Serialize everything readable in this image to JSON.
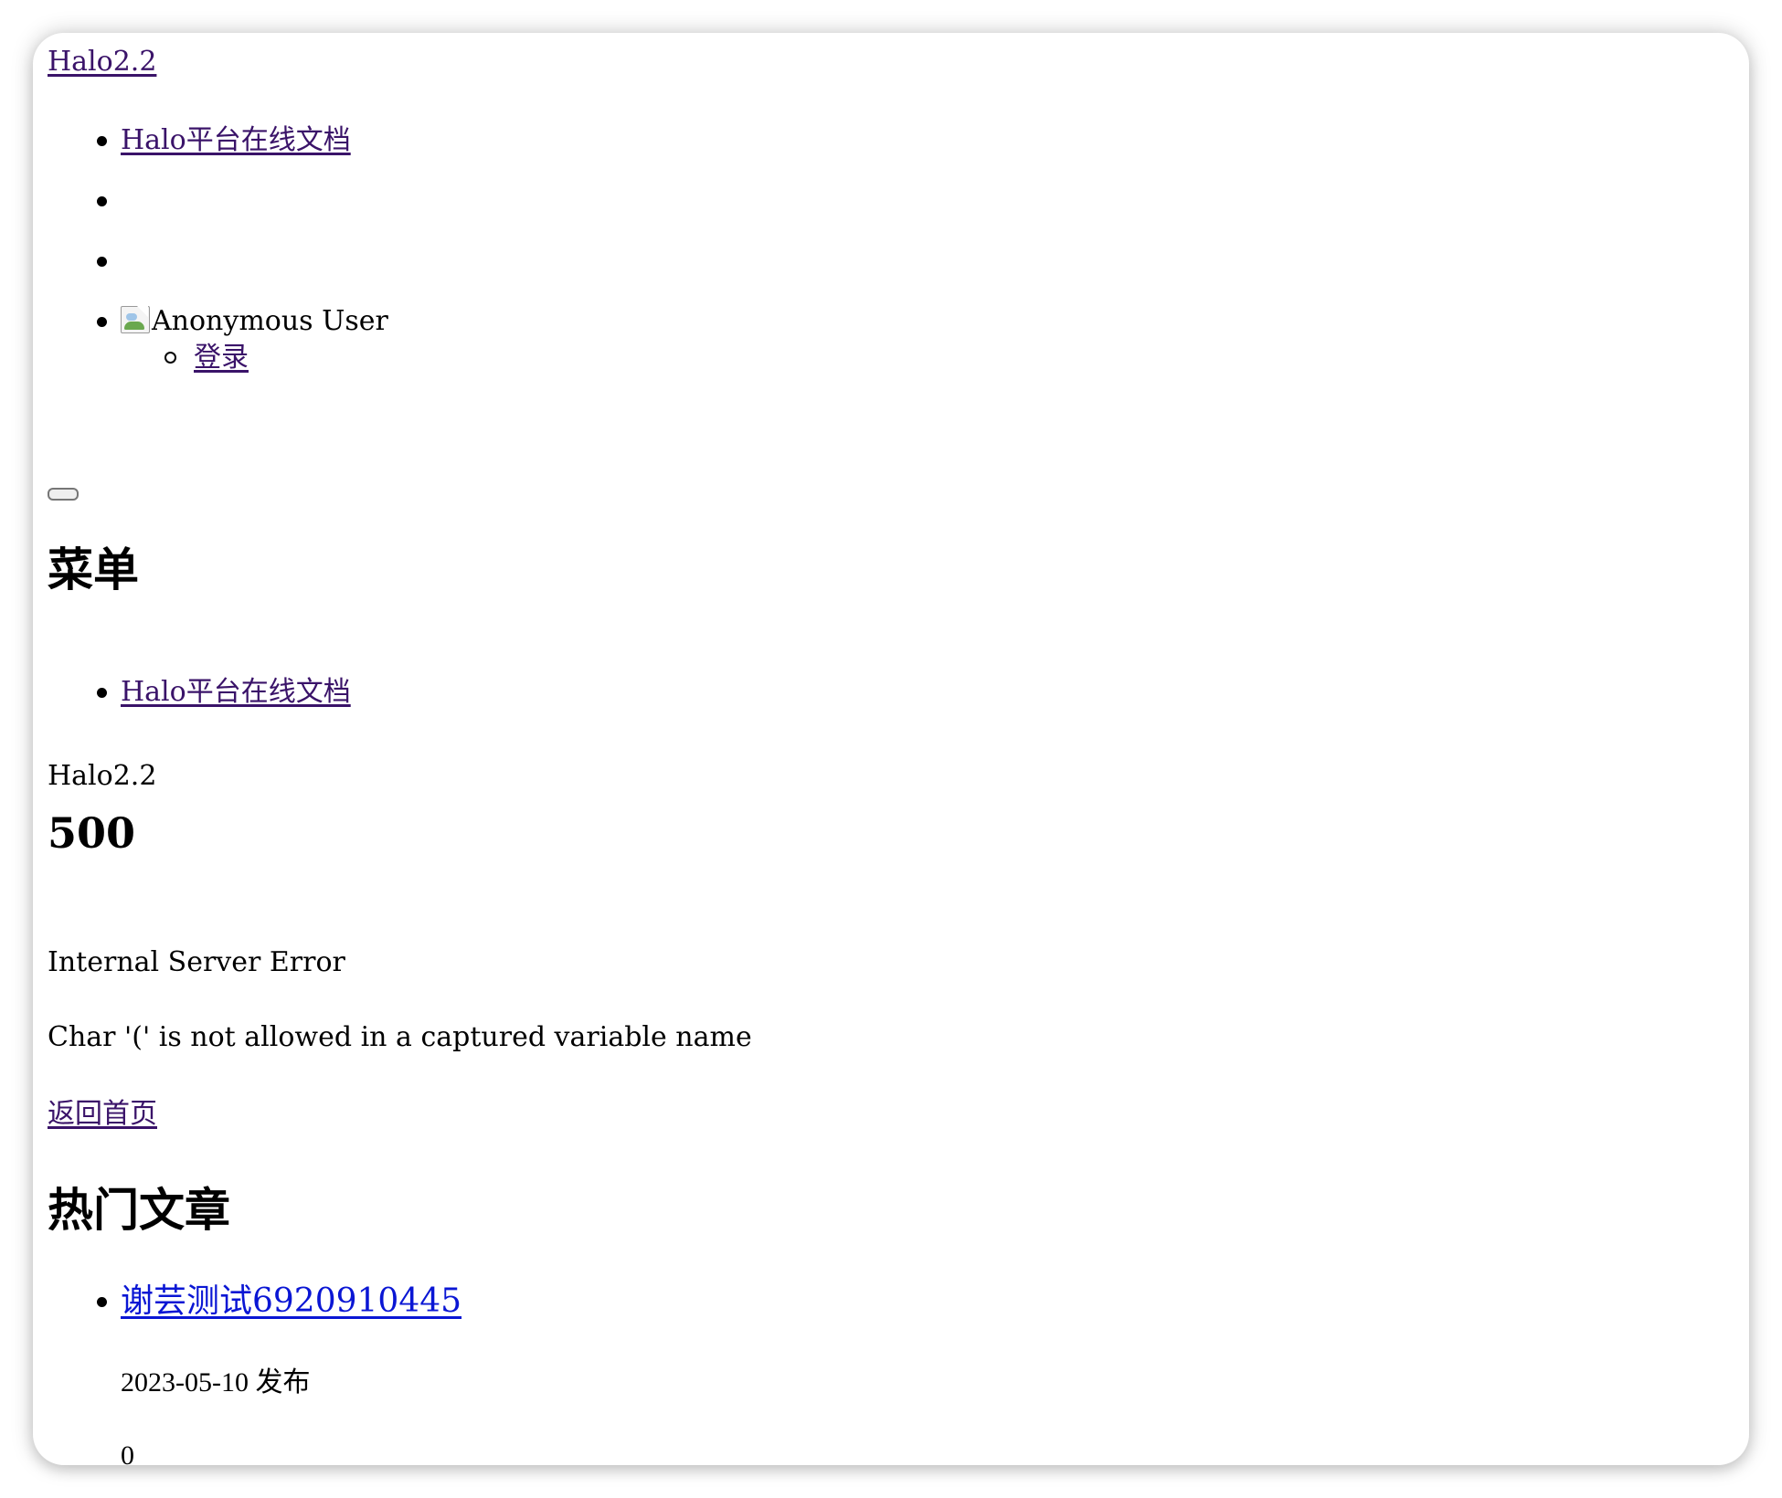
{
  "site": {
    "title": "Halo2.2"
  },
  "nav": {
    "items": [
      {
        "label": "Halo平台在线文档"
      },
      {
        "label": ""
      },
      {
        "label": ""
      }
    ],
    "user": {
      "name": "Anonymous User",
      "menu": [
        {
          "label": "登录"
        }
      ]
    }
  },
  "menu": {
    "heading": "菜单",
    "items": [
      {
        "label": "Halo平台在线文档"
      }
    ],
    "site_name": "Halo2.2"
  },
  "error": {
    "code": "500",
    "title": "Internal Server Error",
    "message": "Char '(' is not allowed in a captured variable name",
    "home_link": "返回首页"
  },
  "hot_posts": {
    "heading": "热门文章",
    "items": [
      {
        "title": "谢芸测试6920910445",
        "date": "2023-05-10 发布",
        "count": "0"
      }
    ]
  },
  "colors": {
    "visited_link": "#3a1369",
    "post_link": "#0a16d4"
  }
}
